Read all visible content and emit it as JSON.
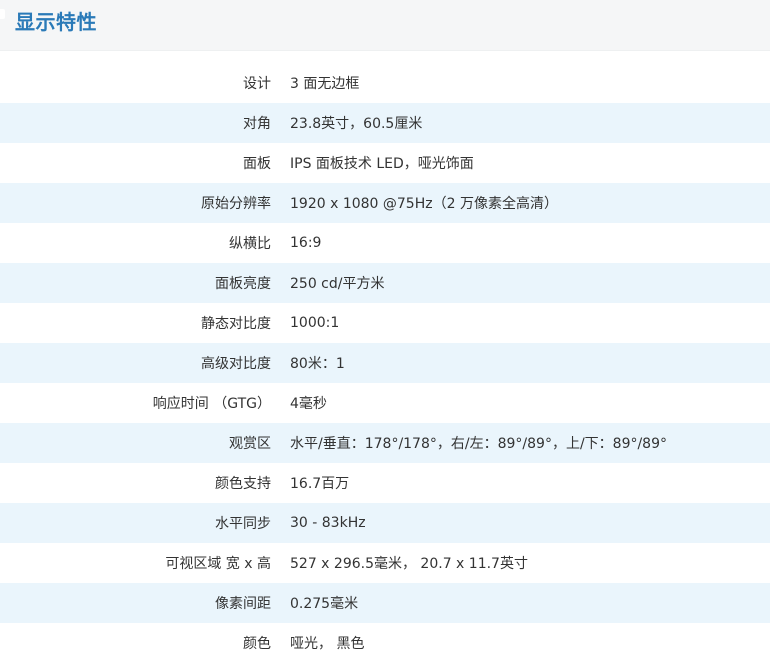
{
  "section": {
    "title": "显示特性"
  },
  "specs": [
    {
      "label": "设计",
      "value": "3 面无边框"
    },
    {
      "label": "对角",
      "value": "23.8英寸，60.5厘米"
    },
    {
      "label": "面板",
      "value": "IPS 面板技术 LED，哑光饰面"
    },
    {
      "label": "原始分辨率",
      "value": "1920 x 1080 @75Hz（2 万像素全高清）"
    },
    {
      "label": "纵横比",
      "value": "16:9"
    },
    {
      "label": "面板亮度",
      "value": "250 cd/平方米"
    },
    {
      "label": "静态对比度",
      "value": "1000:1"
    },
    {
      "label": "高级对比度",
      "value": "80米：1"
    },
    {
      "label": "响应时间 （GTG）",
      "value": "4毫秒"
    },
    {
      "label": "观赏区",
      "value": "水平/垂直：178°/178°，右/左：89°/89°，上/下：89°/89°"
    },
    {
      "label": "颜色支持",
      "value": "16.7百万"
    },
    {
      "label": "水平同步",
      "value": "30 - 83kHz"
    },
    {
      "label": "可视区域 宽 x 高",
      "value": "527 x 296.5毫米， 20.7 x 11.7英寸"
    },
    {
      "label": "像素间距",
      "value": "0.275毫米"
    },
    {
      "label": "颜色",
      "value": "哑光， 黑色"
    }
  ],
  "colors": {
    "title": "#2a7ab8",
    "header_bg": "#f5f6f7",
    "stripe_bg": "#eaf5fc",
    "text": "#333333"
  }
}
